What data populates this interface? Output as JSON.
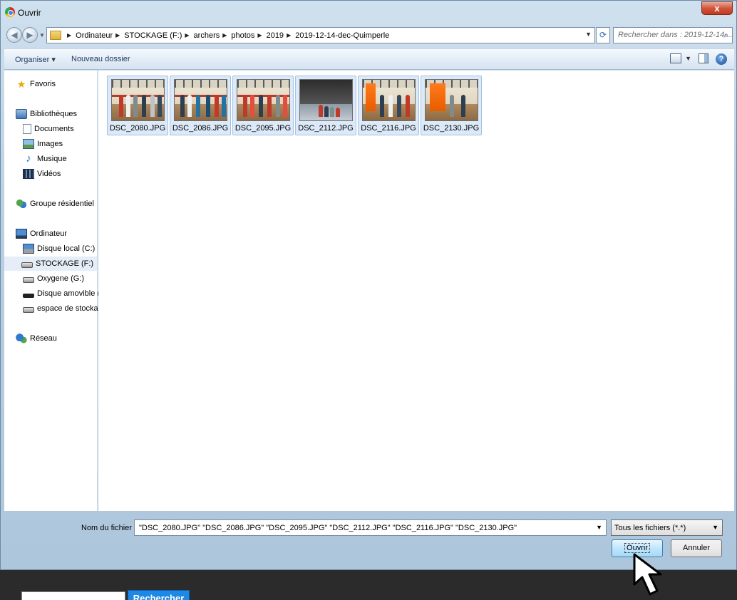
{
  "window": {
    "title": "Ouvrir",
    "close_label": "x"
  },
  "address": {
    "crumbs": [
      "Ordinateur",
      "STOCKAGE (F:)",
      "archers",
      "photos",
      "2019",
      "2019-12-14-dec-Quimperle"
    ],
    "search_placeholder": "Rechercher dans : 2019-12-14-..."
  },
  "toolbar": {
    "organize_label": "Organiser ▾",
    "new_folder_label": "Nouveau dossier",
    "help_label": "?"
  },
  "sidebar": {
    "favorites": "Favoris",
    "libraries": "Bibliothèques",
    "documents": "Documents",
    "images": "Images",
    "music": "Musique",
    "videos": "Vidéos",
    "homegroup": "Groupe résidentiel",
    "computer": "Ordinateur",
    "drive_c": "Disque local (C:)",
    "drive_f": "STOCKAGE (F:)",
    "drive_g": "Oxygene (G:)",
    "drive_h": "Disque amovible (H:",
    "storage": "espace de stockage",
    "network": "Réseau"
  },
  "files": [
    {
      "name": "DSC_2080.JPG"
    },
    {
      "name": "DSC_2086.JPG"
    },
    {
      "name": "DSC_2095.JPG"
    },
    {
      "name": "DSC_2112.JPG"
    },
    {
      "name": "DSC_2116.JPG"
    },
    {
      "name": "DSC_2130.JPG"
    }
  ],
  "bottom": {
    "filename_label": "Nom du fichier :",
    "filename_value": "\"DSC_2080.JPG\" \"DSC_2086.JPG\" \"DSC_2095.JPG\" \"DSC_2112.JPG\" \"DSC_2116.JPG\" \"DSC_2130.JPG\"",
    "filter_value": "Tous les fichiers (*.*)",
    "open_label": "Ouvrir",
    "cancel_label": "Annuler"
  },
  "page": {
    "search_button": "Rechercher"
  }
}
